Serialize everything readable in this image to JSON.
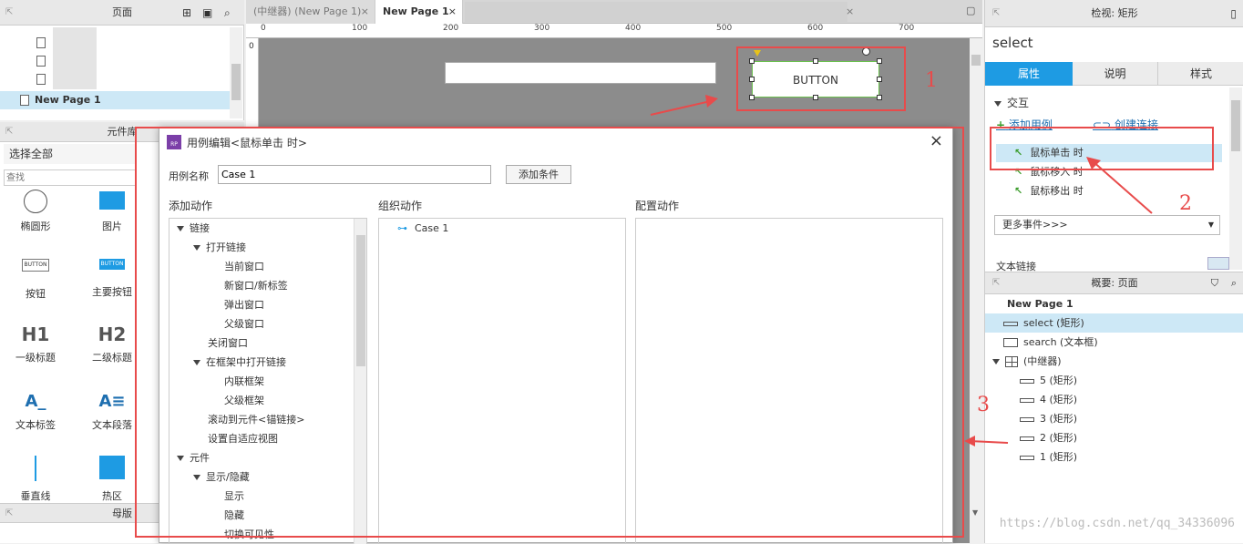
{
  "pages_panel": {
    "title": "页面",
    "pages": [
      {
        "label": "New Page 1"
      }
    ]
  },
  "library_panel": {
    "title": "元件库",
    "select_label": "选择全部",
    "search_placeholder": "查找",
    "widgets": [
      {
        "label": "椭圆形"
      },
      {
        "label": "图片"
      },
      {
        "label": "按钮",
        "thumb": "BUTTON"
      },
      {
        "label": "主要按钮",
        "thumb": "BUTTON"
      },
      {
        "label": "一级标题",
        "thumb": "H1"
      },
      {
        "label": "二级标题",
        "thumb": "H2"
      },
      {
        "label": "文本标签",
        "thumb": "A_"
      },
      {
        "label": "文本段落",
        "thumb": "A≡"
      },
      {
        "label": "垂直线"
      },
      {
        "label": "热区"
      }
    ]
  },
  "masters_panel": {
    "title": "母版"
  },
  "tabs": [
    {
      "label": "(中继器) (New Page 1)"
    },
    {
      "label": "New Page 1"
    }
  ],
  "ruler": {
    "marks": [
      "0",
      "100",
      "200",
      "300",
      "400",
      "500",
      "600",
      "700"
    ],
    "vmark": "0"
  },
  "canvas": {
    "button_text": "BUTTON"
  },
  "inspector": {
    "title": "检视: 矩形",
    "name_value": "select",
    "tabs": [
      "属性",
      "说明",
      "样式"
    ],
    "section": "交互",
    "add_case": "添加用例",
    "create_link": "创建连接",
    "events": [
      "鼠标单击 时",
      "鼠标移入 时",
      "鼠标移出 时"
    ],
    "more_events": "更多事件>>>",
    "text_link": "文本链接"
  },
  "outline": {
    "title": "概要: 页面",
    "root": "New Page 1",
    "items": [
      {
        "label": "select (矩形)",
        "level": 1,
        "type": "rect"
      },
      {
        "label": "search (文本框)",
        "level": 1,
        "type": "textbox"
      },
      {
        "label": "(中继器)",
        "level": 1,
        "type": "repeater"
      },
      {
        "label": "5 (矩形)",
        "level": 2,
        "type": "rect"
      },
      {
        "label": "4 (矩形)",
        "level": 2,
        "type": "rect"
      },
      {
        "label": "3 (矩形)",
        "level": 2,
        "type": "rect"
      },
      {
        "label": "2 (矩形)",
        "level": 2,
        "type": "rect"
      },
      {
        "label": "1 (矩形)",
        "level": 2,
        "type": "rect"
      }
    ]
  },
  "dialog": {
    "title": "用例编辑<鼠标单击 时>",
    "case_name_label": "用例名称",
    "case_name_value": "Case 1",
    "add_condition": "添加条件",
    "col_add": "添加动作",
    "col_org": "组织动作",
    "col_cfg": "配置动作",
    "actions": [
      {
        "label": "链接",
        "level": 0,
        "expand": true
      },
      {
        "label": "打开链接",
        "level": 1,
        "expand": true
      },
      {
        "label": "当前窗口",
        "level": 2
      },
      {
        "label": "新窗口/新标签",
        "level": 2
      },
      {
        "label": "弹出窗口",
        "level": 2
      },
      {
        "label": "父级窗口",
        "level": 2
      },
      {
        "label": "关闭窗口",
        "level": 1
      },
      {
        "label": "在框架中打开链接",
        "level": 1,
        "expand": true
      },
      {
        "label": "内联框架",
        "level": 2
      },
      {
        "label": "父级框架",
        "level": 2
      },
      {
        "label": "滚动到元件<锚链接>",
        "level": 1
      },
      {
        "label": "设置自适应视图",
        "level": 1
      },
      {
        "label": "元件",
        "level": 0,
        "expand": true
      },
      {
        "label": "显示/隐藏",
        "level": 1,
        "expand": true
      },
      {
        "label": "显示",
        "level": 2
      },
      {
        "label": "隐藏",
        "level": 2
      },
      {
        "label": "切换可见性",
        "level": 2
      }
    ],
    "org_case": "Case 1"
  },
  "annotations": [
    "1",
    "2",
    "3"
  ],
  "watermark": "https://blog.csdn.net/qq_34336096",
  "colors": {
    "accent": "#1e9be3",
    "annotation": "#e84b4b",
    "selection": "#cde8f6"
  }
}
